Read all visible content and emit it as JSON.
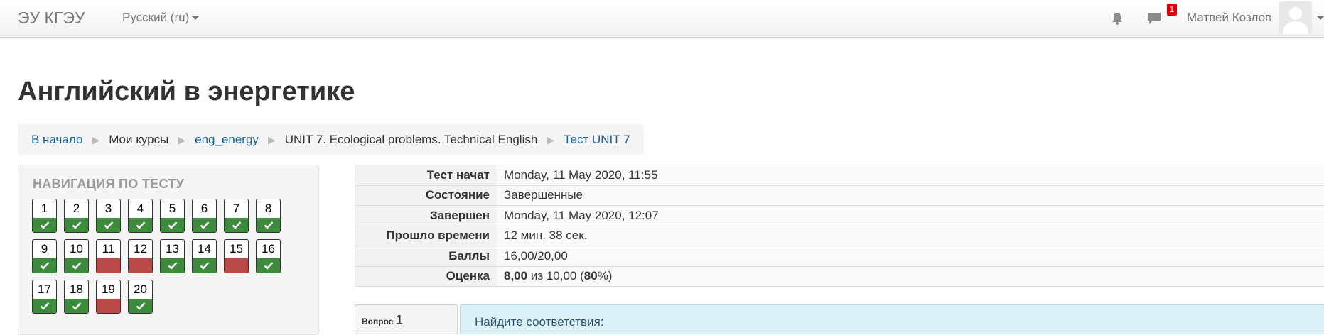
{
  "navbar": {
    "brand": "ЭУ КГЭУ",
    "language": "Русский (ru)",
    "notification_icon": "bell-icon",
    "message_icon": "chat-bubble-icon",
    "message_count": "1",
    "user_name": "Матвей Козлов"
  },
  "header": {
    "title": "Английский в энергетике",
    "breadcrumb": [
      {
        "label": "В начало",
        "link": true
      },
      {
        "label": "Мои курсы",
        "link": false
      },
      {
        "label": "eng_energy",
        "link": true
      },
      {
        "label": "UNIT 7. Ecological problems. Technical English",
        "link": false
      },
      {
        "label": "Тест UNIT 7",
        "link": true
      }
    ]
  },
  "quiz_nav": {
    "title": "НАВИГАЦИЯ ПО ТЕСТУ",
    "questions": [
      {
        "number": "1",
        "state": "correct"
      },
      {
        "number": "2",
        "state": "correct"
      },
      {
        "number": "3",
        "state": "correct"
      },
      {
        "number": "4",
        "state": "correct"
      },
      {
        "number": "5",
        "state": "correct"
      },
      {
        "number": "6",
        "state": "correct"
      },
      {
        "number": "7",
        "state": "correct"
      },
      {
        "number": "8",
        "state": "correct"
      },
      {
        "number": "9",
        "state": "correct"
      },
      {
        "number": "10",
        "state": "correct"
      },
      {
        "number": "11",
        "state": "wrong"
      },
      {
        "number": "12",
        "state": "wrong"
      },
      {
        "number": "13",
        "state": "correct"
      },
      {
        "number": "14",
        "state": "correct"
      },
      {
        "number": "15",
        "state": "wrong"
      },
      {
        "number": "16",
        "state": "correct"
      },
      {
        "number": "17",
        "state": "correct"
      },
      {
        "number": "18",
        "state": "correct"
      },
      {
        "number": "19",
        "state": "wrong"
      },
      {
        "number": "20",
        "state": "correct"
      }
    ]
  },
  "summary": {
    "rows": [
      {
        "label": "Тест начат",
        "value": "Monday, 11 May 2020, 11:55"
      },
      {
        "label": "Состояние",
        "value": "Завершенные"
      },
      {
        "label": "Завершен",
        "value": "Monday, 11 May 2020, 12:07"
      },
      {
        "label": "Прошло времени",
        "value": "12 мин. 38 сек."
      },
      {
        "label": "Баллы",
        "value": "16,00/20,00"
      }
    ],
    "grade": {
      "label": "Оценка",
      "score": "8,00",
      "middle": " из 10,00 (",
      "percent": "80",
      "end": "%)"
    }
  },
  "question": {
    "label": "Вопрос",
    "number": "1",
    "text": "Найдите соответствия:"
  },
  "colors": {
    "correct": "#3d8a3d",
    "wrong": "#b94a48",
    "link": "#1a6496",
    "badge": "#d9000c"
  }
}
